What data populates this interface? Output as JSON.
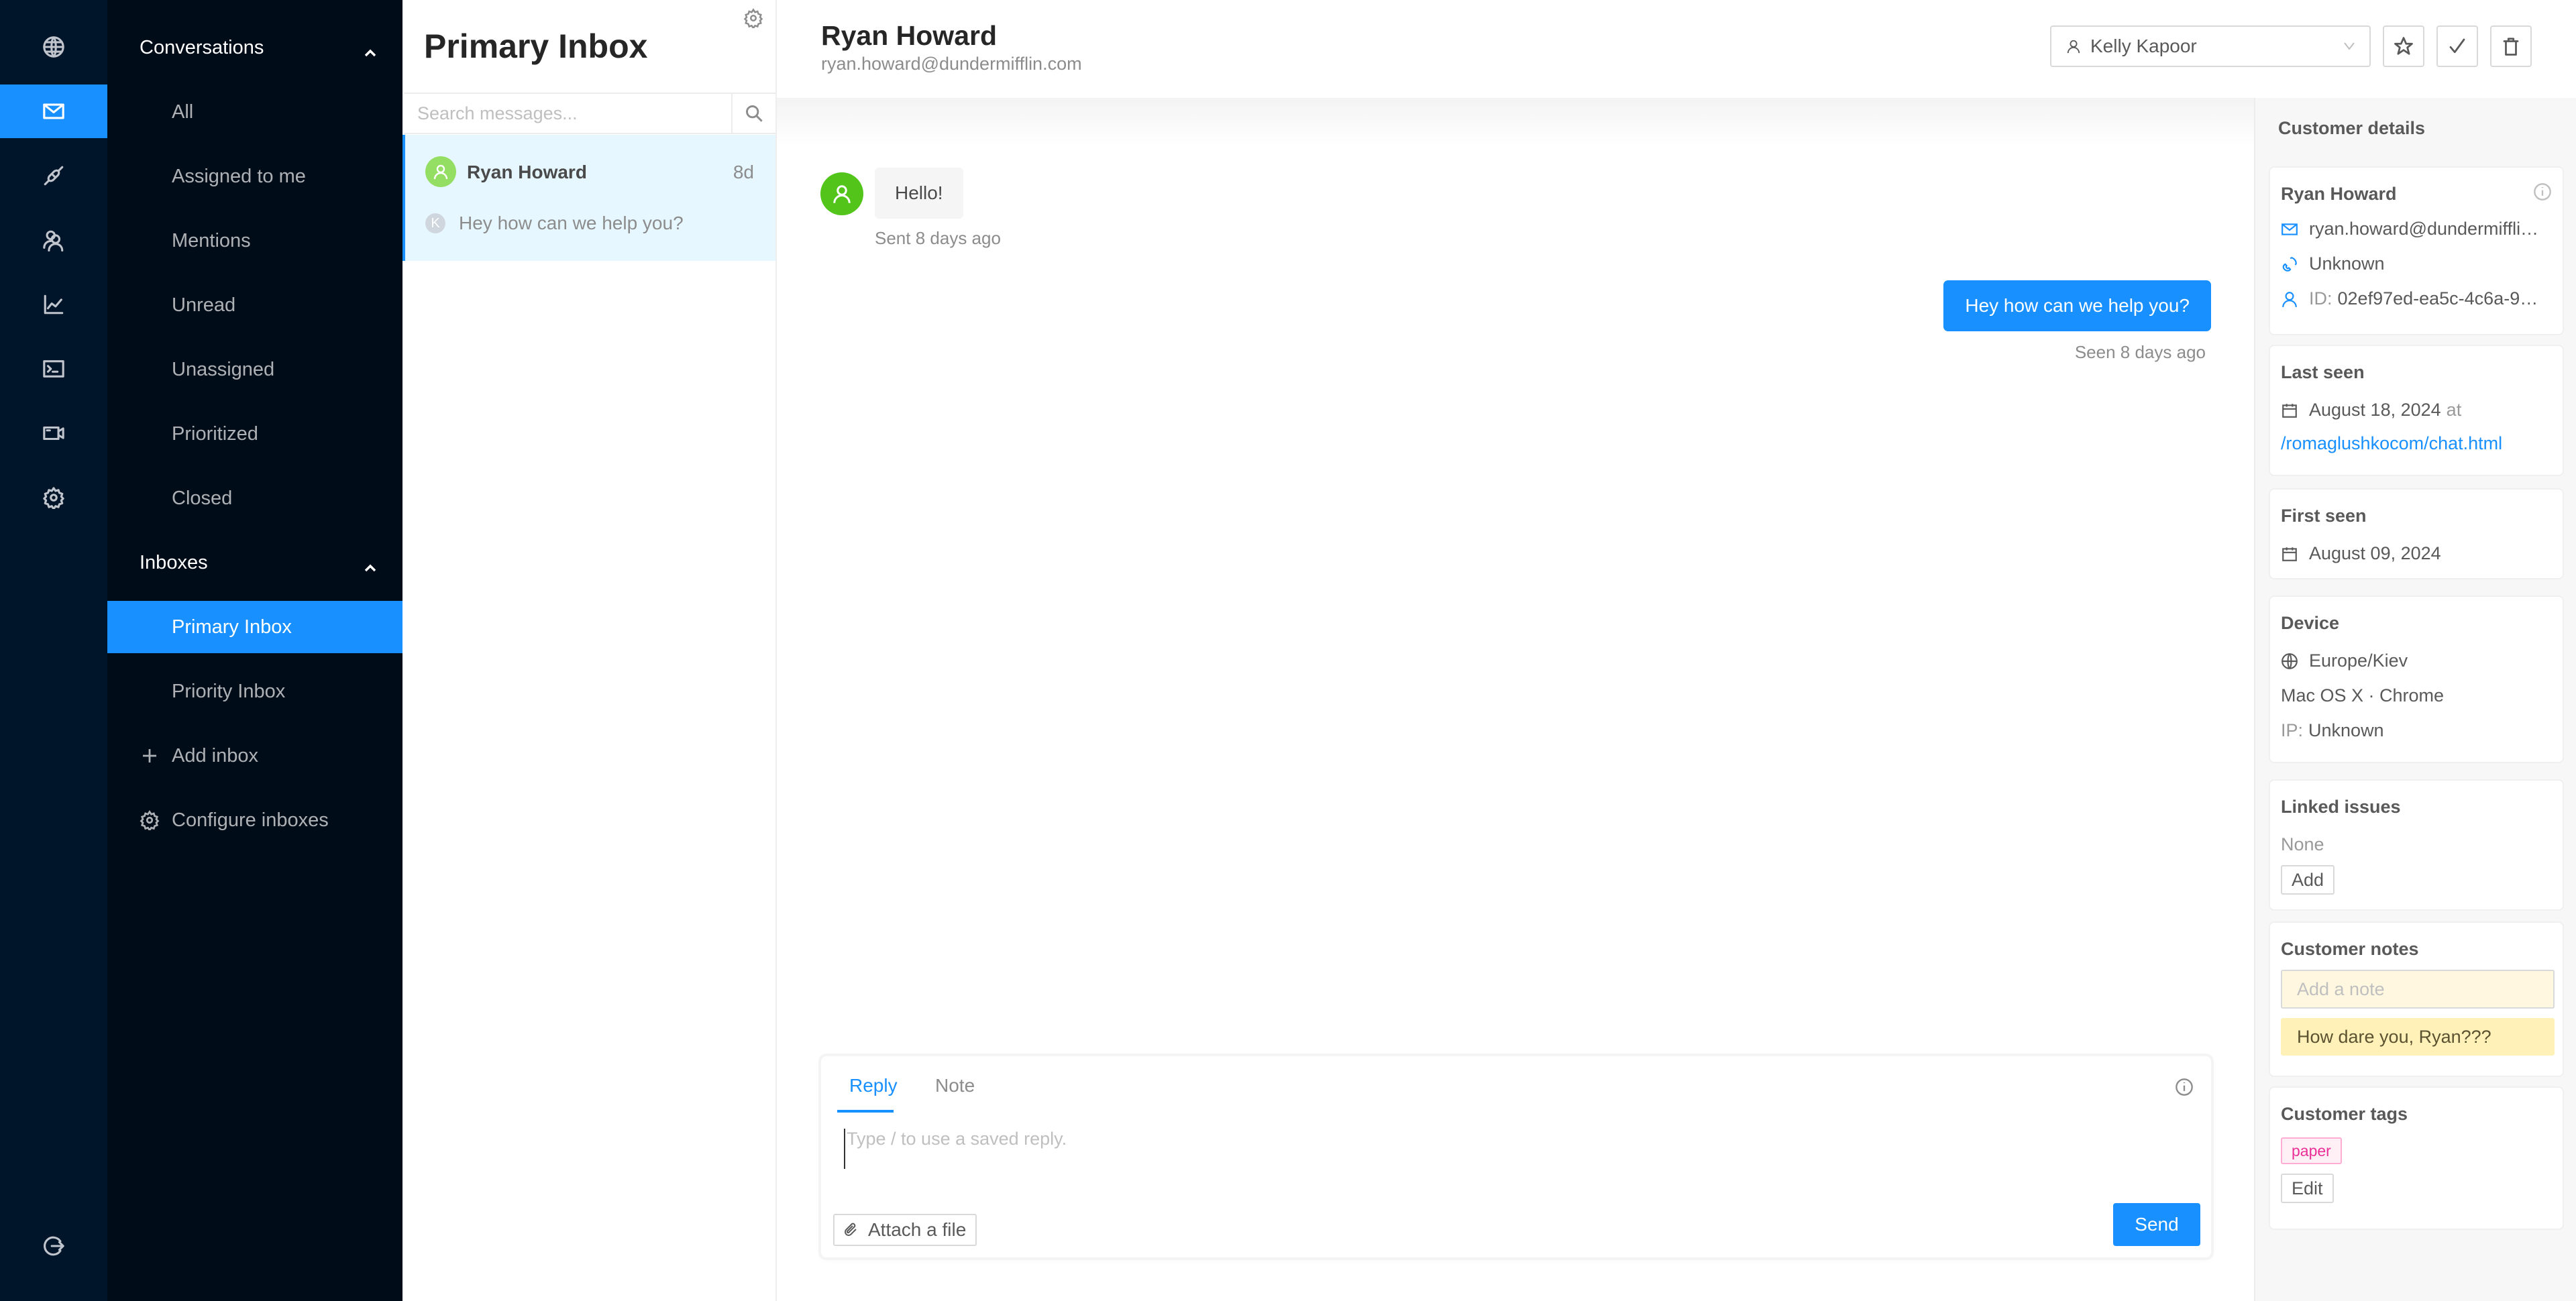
{
  "rail": {
    "items": [
      {
        "icon": "globe-icon",
        "label": "Sessions"
      },
      {
        "icon": "mail-icon",
        "label": "Conversations",
        "active": true
      },
      {
        "icon": "plug-icon",
        "label": "Integrations"
      },
      {
        "icon": "users-icon",
        "label": "Customers"
      },
      {
        "icon": "chart-icon",
        "label": "Reporting"
      },
      {
        "icon": "terminal-icon",
        "label": "Developers"
      },
      {
        "icon": "video-icon",
        "label": "Sessions video"
      },
      {
        "icon": "gear-icon",
        "label": "Settings"
      }
    ],
    "logout_icon": "logout-icon"
  },
  "nav": {
    "conversations_label": "Conversations",
    "conversation_items": [
      "All",
      "Assigned to me",
      "Mentions",
      "Unread",
      "Unassigned",
      "Prioritized",
      "Closed"
    ],
    "inboxes_label": "Inboxes",
    "inbox_items": [
      "Primary Inbox",
      "Priority Inbox"
    ],
    "active_inbox": "Primary Inbox",
    "add_inbox_label": "Add inbox",
    "configure_inboxes_label": "Configure inboxes"
  },
  "list": {
    "title": "Primary Inbox",
    "search_placeholder": "Search messages...",
    "conversations": [
      {
        "customer_name": "Ryan Howard",
        "time_ago": "8d",
        "agent_initial": "K",
        "preview": "Hey how can we help you?",
        "selected": true
      }
    ]
  },
  "chat": {
    "customer_name": "Ryan Howard",
    "customer_email": "ryan.howard@dundermifflin.com",
    "assignee": "Kelly Kapoor",
    "actions": [
      "star",
      "resolve",
      "delete"
    ],
    "messages": [
      {
        "direction": "inbound",
        "text": "Hello!",
        "meta": "Sent 8 days ago"
      },
      {
        "direction": "outbound",
        "text": "Hey how can we help you?",
        "meta": "Seen 8 days ago"
      }
    ],
    "composer": {
      "tabs": [
        "Reply",
        "Note"
      ],
      "active_tab": "Reply",
      "placeholder": "Type / to use a saved reply.",
      "value": "",
      "attach_label": "Attach a file",
      "send_label": "Send"
    }
  },
  "details": {
    "title": "Customer details",
    "customer": {
      "name": "Ryan Howard",
      "email": "ryan.howard@dundermiffli…",
      "phone": "Unknown",
      "id_label": "ID:",
      "id_value": "02ef97ed-ea5c-4c6a-9…"
    },
    "last_seen": {
      "title": "Last seen",
      "date": "August 18, 2024",
      "at_label": "at",
      "page": "/romaglushkocom/chat.html"
    },
    "first_seen": {
      "title": "First seen",
      "date": "August 09, 2024"
    },
    "device": {
      "title": "Device",
      "timezone": "Europe/Kiev",
      "os_browser": "Mac OS X · Chrome",
      "ip_label": "IP:",
      "ip_value": "Unknown"
    },
    "linked_issues": {
      "title": "Linked issues",
      "value": "None",
      "add_label": "Add"
    },
    "notes": {
      "title": "Customer notes",
      "placeholder": "Add a note",
      "items": [
        "How dare you, Ryan???"
      ]
    },
    "tags": {
      "title": "Customer tags",
      "items": [
        "paper"
      ],
      "edit_label": "Edit"
    }
  },
  "colors": {
    "accent": "#1890ff",
    "rail_bg": "#001529",
    "nav_bg": "#000c17",
    "customer_avatar": "#52c41a",
    "selected_conversation_bg": "#e6f7ff",
    "note_bg": "#fff1b8",
    "tag_color": "#eb2f96"
  }
}
